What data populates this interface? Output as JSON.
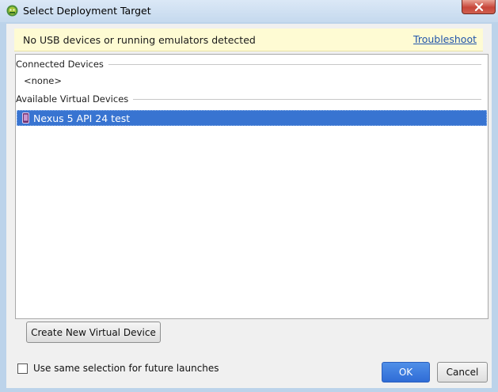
{
  "window": {
    "title": "Select Deployment Target",
    "app_icon": "android-studio-icon",
    "close_icon": "close-icon"
  },
  "notice": {
    "message": "No USB devices or running emulators detected",
    "link_label": "Troubleshoot"
  },
  "device_list": {
    "connected_header": "Connected Devices",
    "connected_items": [
      "<none>"
    ],
    "virtual_header": "Available Virtual Devices",
    "virtual_items": [
      {
        "name": "Nexus 5 API 24 test",
        "icon": "phone-icon",
        "selected": true
      }
    ]
  },
  "footer": {
    "create_button": "Create New Virtual Device",
    "checkbox_label": "Use same selection for future launches",
    "checkbox_checked": false,
    "ok_button": "OK",
    "cancel_button": "Cancel"
  },
  "colors": {
    "selection": "#3874d1",
    "notice_bg": "#fefbd3",
    "link": "#2255aa",
    "primary_button": "#2f6cd6"
  }
}
